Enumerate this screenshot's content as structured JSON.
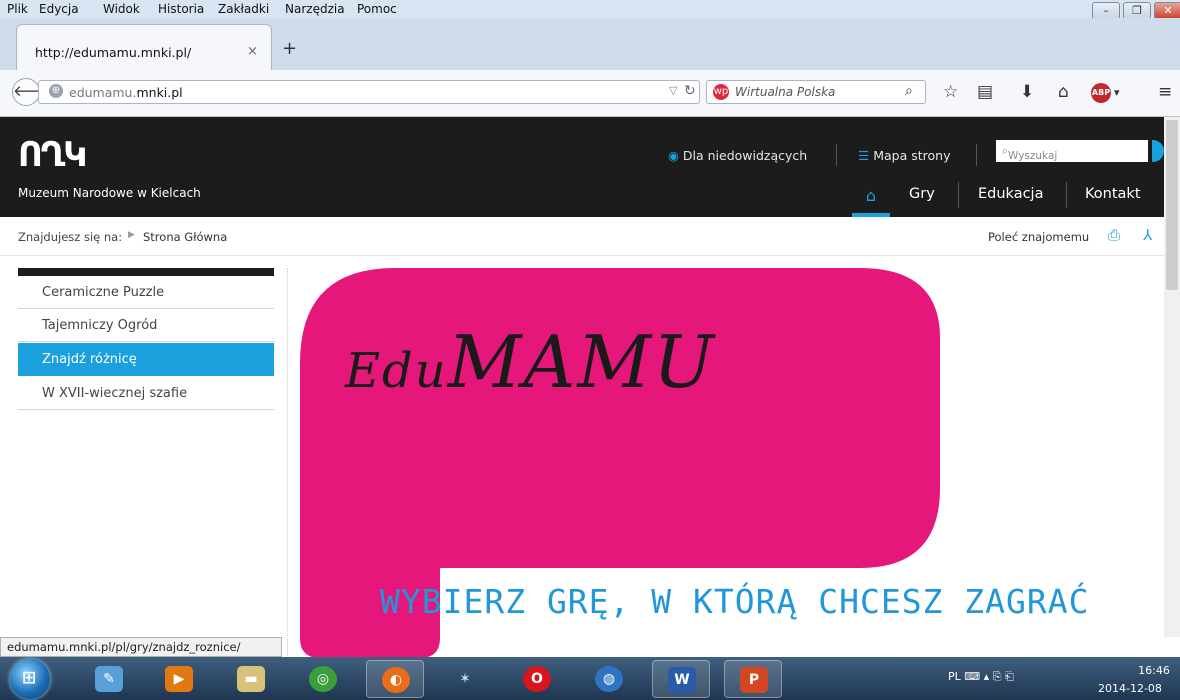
{
  "browser": {
    "menu": [
      "Plik",
      "Edycja",
      "Widok",
      "Historia",
      "Zakładki",
      "Narzędzia",
      "Pomoc"
    ],
    "tab_title": "http://edumamu.mnki.pl/",
    "tab_close": "×",
    "new_tab": "+",
    "url_gray": "edumamu.",
    "url_bold": "mnki.pl",
    "search_engine": "Wirtualna Polska",
    "status_url": "edumamu.mnki.pl/pl/gry/znajdz_roznice/"
  },
  "site": {
    "logo_mark": "ՈՂԿ",
    "logo_text": "Muzeum Narodowe w Kielcach",
    "low_vision": "Dla niedowidzących",
    "sitemap": "Mapa strony",
    "search_placeholder": "Wyszukaj",
    "nav": [
      "Gry",
      "Edukacja",
      "Kontakt"
    ],
    "breadcrumb_label": "Znajdujesz się na:",
    "breadcrumb_home": "Strona Główna",
    "recommend": "Poleć znajomemu",
    "sidebar": [
      {
        "label": "Ceramiczne Puzzle",
        "active": false
      },
      {
        "label": "Tajemniczy Ogród",
        "active": false
      },
      {
        "label": "Znajdź różnicę",
        "active": true
      },
      {
        "label": "W XVII-wiecznej szafie",
        "active": false
      }
    ],
    "banner_title_prefix": "Edu",
    "banner_title_main": "MAMU",
    "banner_subtitle": "WYBIERZ GRĘ, W KTÓRĄ CHCESZ ZAGRAĆ",
    "banner_color": "#e5177a",
    "accent_color": "#1aa0dd"
  },
  "taskbar": {
    "language": "PL",
    "time": "16:46",
    "date": "2014-12-08"
  }
}
